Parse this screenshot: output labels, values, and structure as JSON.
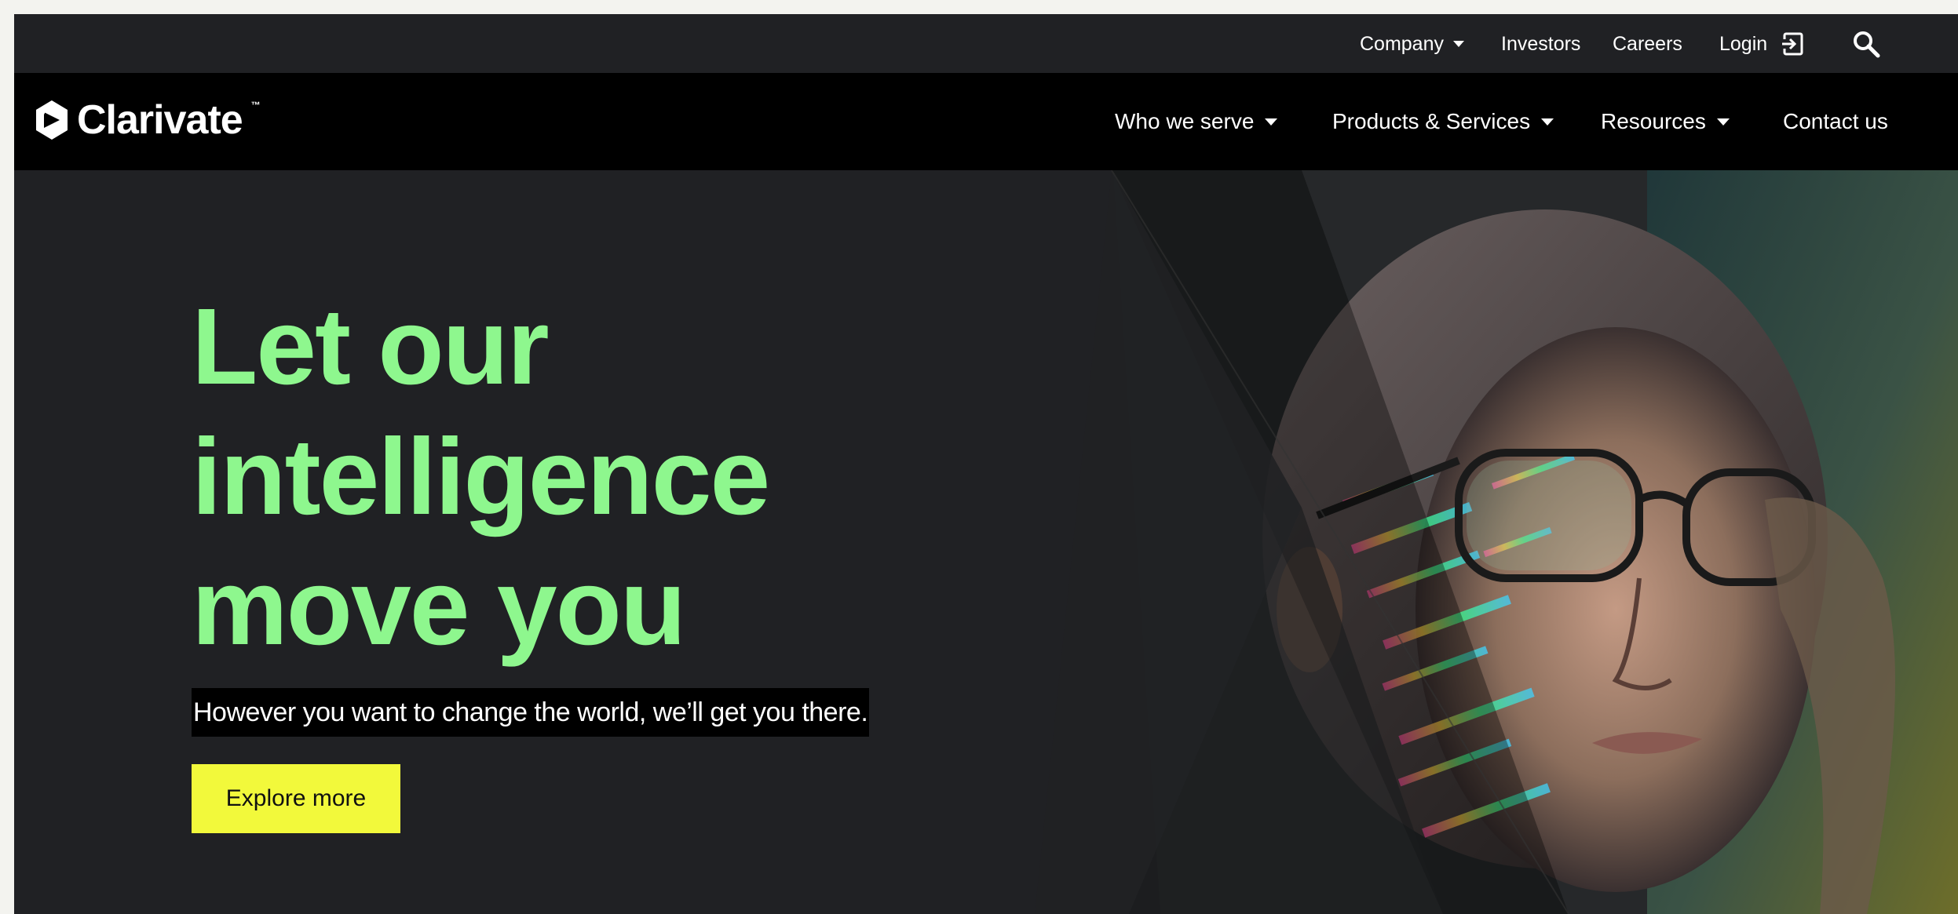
{
  "utility_nav": {
    "company": "Company",
    "investors": "Investors",
    "careers": "Careers",
    "login": "Login"
  },
  "logo": {
    "name": "Clarivate",
    "tm": "™"
  },
  "main_nav": {
    "who_we_serve": "Who we serve",
    "products_services": "Products & Services",
    "resources": "Resources",
    "contact": "Contact us"
  },
  "hero": {
    "headline": [
      "Let our",
      "intelligence",
      "move you"
    ],
    "subline": "However you want to change the world, we’ll get you there.",
    "cta": "Explore more"
  },
  "colors": {
    "headline": "#8ef78e",
    "cta_bg": "#f2f93b",
    "nav_bg": "#000000",
    "page_bg": "#202124"
  },
  "icons": [
    "chevron-down-icon",
    "login-icon",
    "search-icon",
    "clarivate-logo-icon"
  ]
}
